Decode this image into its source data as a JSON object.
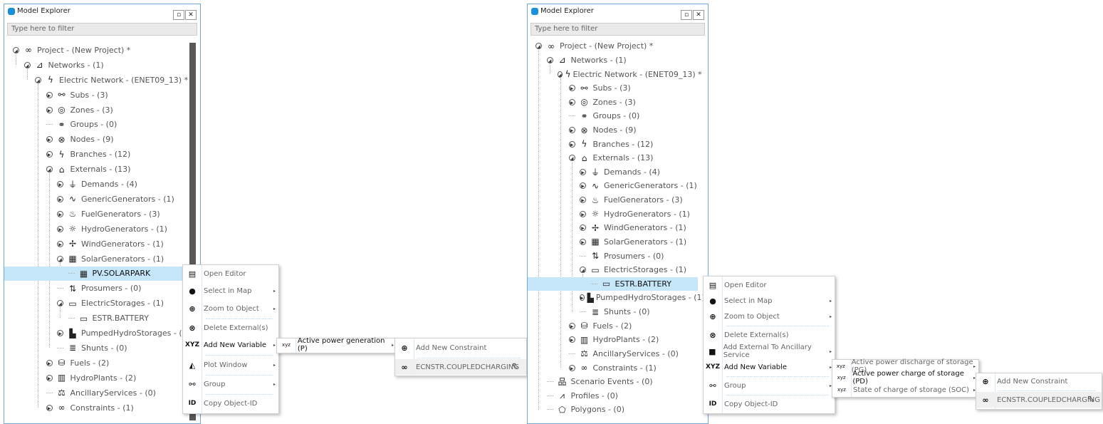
{
  "panels": [
    {
      "title": "Model Explorer",
      "filter_placeholder": "Type here to filter",
      "tree": [
        {
          "level": 0,
          "label": "Project - (New Project) *",
          "icon": "infinity-icon",
          "expanded": true
        },
        {
          "level": 1,
          "label": "Networks - (1)",
          "icon": "network-icon",
          "expanded": true
        },
        {
          "level": 2,
          "label": "Electric Network - (ENET09_13) *",
          "icon": "lightning-icon",
          "expanded": true
        },
        {
          "level": 3,
          "label": "Subs - (3)",
          "icon": "subs-icon",
          "expanded": false
        },
        {
          "level": 3,
          "label": "Zones - (3)",
          "icon": "zones-icon",
          "expanded": false
        },
        {
          "level": 3,
          "label": "Groups - (0)",
          "icon": "groups-icon",
          "expanded": null
        },
        {
          "level": 3,
          "label": "Nodes - (9)",
          "icon": "nodes-icon",
          "expanded": false
        },
        {
          "level": 3,
          "label": "Branches - (12)",
          "icon": "branches-icon",
          "expanded": false
        },
        {
          "level": 3,
          "label": "Externals - (13)",
          "icon": "externals-icon",
          "expanded": true
        },
        {
          "level": 4,
          "label": "Demands - (4)",
          "icon": "plug-icon",
          "expanded": false
        },
        {
          "level": 4,
          "label": "GenericGenerators - (1)",
          "icon": "generator-icon",
          "expanded": false
        },
        {
          "level": 4,
          "label": "FuelGenerators - (3)",
          "icon": "fuel-generator-icon",
          "expanded": false
        },
        {
          "level": 4,
          "label": "HydroGenerators - (1)",
          "icon": "hydro-icon",
          "expanded": false
        },
        {
          "level": 4,
          "label": "WindGenerators - (1)",
          "icon": "wind-turbine-icon",
          "expanded": false
        },
        {
          "level": 4,
          "label": "SolarGenerators - (1)",
          "icon": "solar-panel-icon",
          "expanded": true
        },
        {
          "level": 5,
          "label": "PV.SOLARPARK",
          "icon": "solar-panel-icon",
          "expanded": null,
          "selected": true
        },
        {
          "level": 4,
          "label": "Prosumers - (0)",
          "icon": "prosumer-icon",
          "expanded": null
        },
        {
          "level": 4,
          "label": "ElectricStorages - (1)",
          "icon": "battery-icon",
          "expanded": true
        },
        {
          "level": 5,
          "label": "ESTR.BATTERY",
          "icon": "battery-icon",
          "expanded": null
        },
        {
          "level": 4,
          "label": "PumpedHydroStorages - (1)",
          "icon": "pumped-hydro-icon",
          "expanded": false
        },
        {
          "level": 4,
          "label": "Shunts - (0)",
          "icon": "shunt-icon",
          "expanded": null
        },
        {
          "level": 3,
          "label": "Fuels - (2)",
          "icon": "fuel-barrel-icon",
          "expanded": false
        },
        {
          "level": 3,
          "label": "HydroPlants - (2)",
          "icon": "hydro-plant-icon",
          "expanded": false
        },
        {
          "level": 3,
          "label": "AncillaryServices - (0)",
          "icon": "scales-icon",
          "expanded": null
        },
        {
          "level": 3,
          "label": "Constraints - (1)",
          "icon": "chain-link-icon",
          "expanded": false
        }
      ],
      "context_menu": [
        {
          "label": "Open Editor",
          "icon": "editor-icon"
        },
        {
          "label": "Select in Map",
          "icon": "map-select-icon",
          "submenu": true
        },
        {
          "label": "Zoom to Object",
          "icon": "zoom-in-icon",
          "submenu": true,
          "sep_after": true
        },
        {
          "label": "Delete External(s)",
          "icon": "delete-external-icon"
        },
        {
          "label": "Add New Variable",
          "icon": "add-variable-xyz-icon",
          "submenu": true,
          "active": true,
          "sep_after": true
        },
        {
          "label": "Plot Window",
          "icon": "plot-icon",
          "submenu": true,
          "sep_after": true
        },
        {
          "label": "Group",
          "icon": "group-icon",
          "submenu": true,
          "sep_after": true
        },
        {
          "label": "Copy Object-ID",
          "icon": "id-icon"
        }
      ],
      "variable_submenu": [
        {
          "label": "Active power generation (P)",
          "icon": "xyz-icon",
          "active": true
        }
      ],
      "constraint_submenu": [
        {
          "label": "Add New Constraint",
          "icon": "add-constraint-icon",
          "sep_after": true
        },
        {
          "label": "ECNSTR.COUPLEDCHARGING",
          "icon": "chain-link-icon",
          "hover": true
        }
      ]
    },
    {
      "title": "Model Explorer",
      "filter_placeholder": "Type here to filter",
      "tree": [
        {
          "level": 0,
          "label": "Project - (New Project) *",
          "icon": "infinity-icon",
          "expanded": true
        },
        {
          "level": 1,
          "label": "Networks - (1)",
          "icon": "network-icon",
          "expanded": true
        },
        {
          "level": 2,
          "label": "Electric Network - (ENET09_13) *",
          "icon": "lightning-icon",
          "expanded": true
        },
        {
          "level": 3,
          "label": "Subs - (3)",
          "icon": "subs-icon",
          "expanded": false
        },
        {
          "level": 3,
          "label": "Zones - (3)",
          "icon": "zones-icon",
          "expanded": false
        },
        {
          "level": 3,
          "label": "Groups - (0)",
          "icon": "groups-icon",
          "expanded": null
        },
        {
          "level": 3,
          "label": "Nodes - (9)",
          "icon": "nodes-icon",
          "expanded": false
        },
        {
          "level": 3,
          "label": "Branches - (12)",
          "icon": "branches-icon",
          "expanded": false
        },
        {
          "level": 3,
          "label": "Externals - (13)",
          "icon": "externals-icon",
          "expanded": true
        },
        {
          "level": 4,
          "label": "Demands - (4)",
          "icon": "plug-icon",
          "expanded": false
        },
        {
          "level": 4,
          "label": "GenericGenerators - (1)",
          "icon": "generator-icon",
          "expanded": false
        },
        {
          "level": 4,
          "label": "FuelGenerators - (3)",
          "icon": "fuel-generator-icon",
          "expanded": false
        },
        {
          "level": 4,
          "label": "HydroGenerators - (1)",
          "icon": "hydro-icon",
          "expanded": false
        },
        {
          "level": 4,
          "label": "WindGenerators - (1)",
          "icon": "wind-turbine-icon",
          "expanded": false
        },
        {
          "level": 4,
          "label": "SolarGenerators - (1)",
          "icon": "solar-panel-icon",
          "expanded": false
        },
        {
          "level": 4,
          "label": "Prosumers - (0)",
          "icon": "prosumer-icon",
          "expanded": null
        },
        {
          "level": 4,
          "label": "ElectricStorages - (1)",
          "icon": "battery-icon",
          "expanded": true
        },
        {
          "level": 5,
          "label": "ESTR.BATTERY",
          "icon": "battery-icon",
          "expanded": null,
          "selected": true
        },
        {
          "level": 4,
          "label": "PumpedHydroStorages - (1)",
          "icon": "pumped-hydro-icon",
          "expanded": false
        },
        {
          "level": 4,
          "label": "Shunts - (0)",
          "icon": "shunt-icon",
          "expanded": null
        },
        {
          "level": 3,
          "label": "Fuels - (2)",
          "icon": "fuel-barrel-icon",
          "expanded": false
        },
        {
          "level": 3,
          "label": "HydroPlants - (2)",
          "icon": "hydro-plant-icon",
          "expanded": false
        },
        {
          "level": 3,
          "label": "AncillaryServices - (0)",
          "icon": "scales-icon",
          "expanded": null
        },
        {
          "level": 3,
          "label": "Constraints - (1)",
          "icon": "chain-link-icon",
          "expanded": false
        },
        {
          "level": 1,
          "label": "Scenario Events - (0)",
          "icon": "scenario-events-icon",
          "expanded": null
        },
        {
          "level": 1,
          "label": "Profiles - (0)",
          "icon": "profile-curve-icon",
          "expanded": null
        },
        {
          "level": 1,
          "label": "Polygons - (0)",
          "icon": "pentagon-icon",
          "expanded": null
        }
      ],
      "context_menu": [
        {
          "label": "Open Editor",
          "icon": "editor-icon"
        },
        {
          "label": "Select in Map",
          "icon": "map-select-icon",
          "submenu": true
        },
        {
          "label": "Zoom to Object",
          "icon": "zoom-in-icon",
          "submenu": true,
          "sep_after": true
        },
        {
          "label": "Delete External(s)",
          "icon": "delete-external-icon"
        },
        {
          "label": "Add External To Ancillary Service",
          "icon": "add-ancillary-icon",
          "submenu": true
        },
        {
          "label": "Add New Variable",
          "icon": "add-variable-xyz-icon",
          "submenu": true,
          "active": true,
          "sep_after": true
        },
        {
          "label": "Group",
          "icon": "group-icon",
          "submenu": true,
          "sep_after": true
        },
        {
          "label": "Copy Object-ID",
          "icon": "id-icon"
        }
      ],
      "variable_submenu": [
        {
          "label": "Active power discharge of storage (PG)",
          "icon": "xyz-icon"
        },
        {
          "label": "Active power charge of storage (PD)",
          "icon": "xyz-icon",
          "active": true
        },
        {
          "label": "State of charge of storage (SOC)",
          "icon": "xyz-icon"
        }
      ],
      "constraint_submenu": [
        {
          "label": "Add New Constraint",
          "icon": "add-constraint-icon",
          "sep_after": true
        },
        {
          "label": "ECNSTR.COUPLEDCHARGING",
          "icon": "chain-link-icon",
          "hover": true
        }
      ]
    }
  ]
}
